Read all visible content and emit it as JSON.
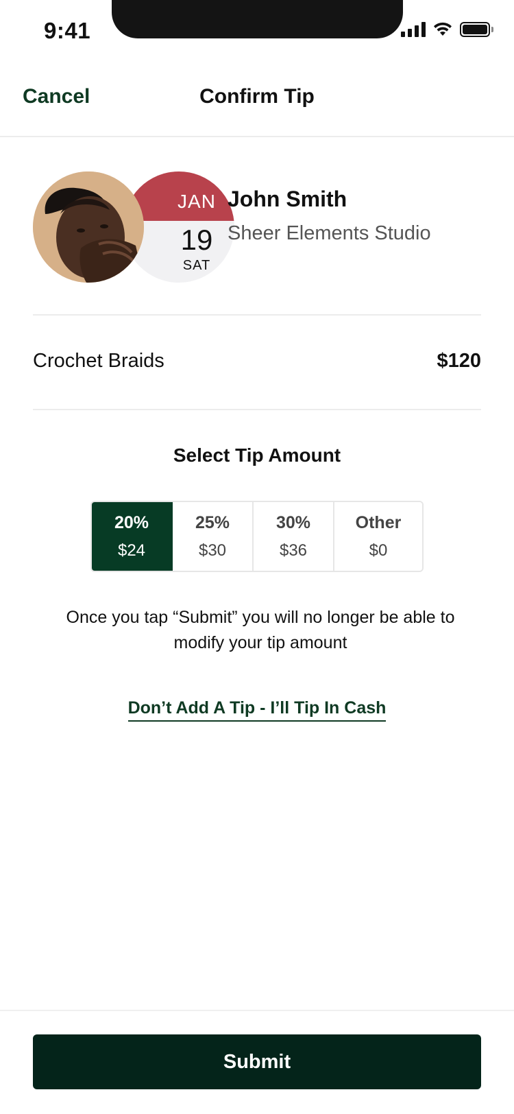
{
  "status_bar": {
    "time": "9:41",
    "icons": [
      "signal-icon",
      "wifi-icon",
      "battery-icon"
    ]
  },
  "nav": {
    "cancel_label": "Cancel",
    "title": "Confirm Tip"
  },
  "appointment": {
    "month": "JAN",
    "day": "19",
    "weekday": "SAT",
    "stylist_name": "John Smith",
    "studio": "Sheer Elements Studio"
  },
  "service": {
    "name": "Crochet Braids",
    "price": "$120"
  },
  "tip": {
    "heading": "Select Tip Amount",
    "options": [
      {
        "percent": "20%",
        "amount": "$24",
        "selected": true
      },
      {
        "percent": "25%",
        "amount": "$30",
        "selected": false
      },
      {
        "percent": "30%",
        "amount": "$36",
        "selected": false
      },
      {
        "percent": "Other",
        "amount": "$0",
        "selected": false
      }
    ],
    "note": "Once you tap “Submit” you will no longer be able to modify your tip amount",
    "cash_link": "Don’t Add A Tip - I’ll Tip In Cash"
  },
  "footer": {
    "submit_label": "Submit"
  },
  "colors": {
    "brand_green": "#073b25",
    "date_red": "#b8424c",
    "submit_bg": "#04241a"
  }
}
